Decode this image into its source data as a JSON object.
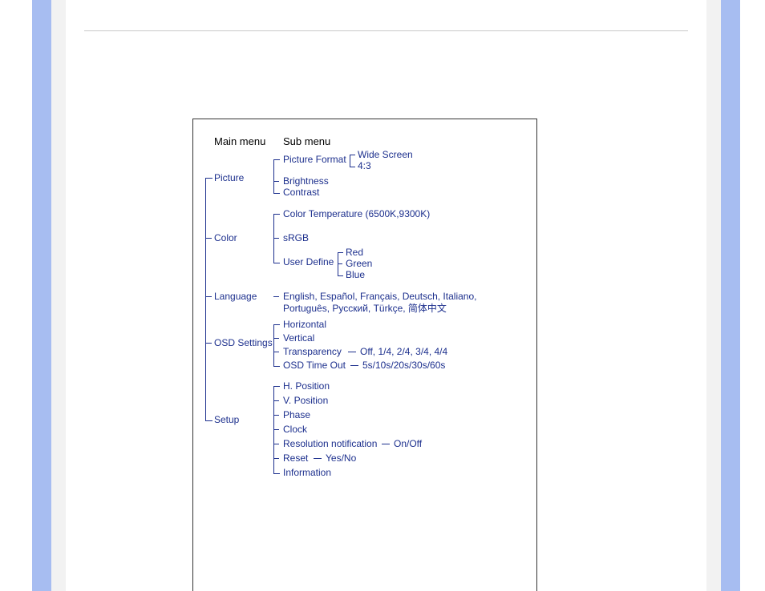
{
  "headers": {
    "main": "Main menu",
    "sub": "Sub menu"
  },
  "main_items": {
    "picture": "Picture",
    "color": "Color",
    "language": "Language",
    "osd": "OSD Settings",
    "setup": "Setup"
  },
  "picture": {
    "format": "Picture Format",
    "format_opts": {
      "wide": "Wide Screen",
      "fourthree": "4:3"
    },
    "brightness": "Brightness",
    "contrast": "Contrast"
  },
  "color": {
    "temp": "Color Temperature (6500K,9300K)",
    "srgb": "sRGB",
    "userdef": "User Define",
    "ud_opts": {
      "red": "Red",
      "green": "Green",
      "blue": "Blue"
    }
  },
  "language": {
    "list": "English, Español, Français, Deutsch, Italiano, Português, Русский, Türkçe, 简体中文"
  },
  "osd": {
    "horizontal": "Horizontal",
    "vertical": "Vertical",
    "transparency": "Transparency",
    "transparency_opts": "Off, 1/4, 2/4, 3/4, 4/4",
    "timeout": "OSD Time Out",
    "timeout_opts": "5s/10s/20s/30s/60s"
  },
  "setup": {
    "hpos": "H. Position",
    "vpos": "V. Position",
    "phase": "Phase",
    "clock": "Clock",
    "resnotif": "Resolution notification",
    "resnotif_opts": "On/Off",
    "reset": "Reset",
    "reset_opts": "Yes/No",
    "info": "Information"
  }
}
